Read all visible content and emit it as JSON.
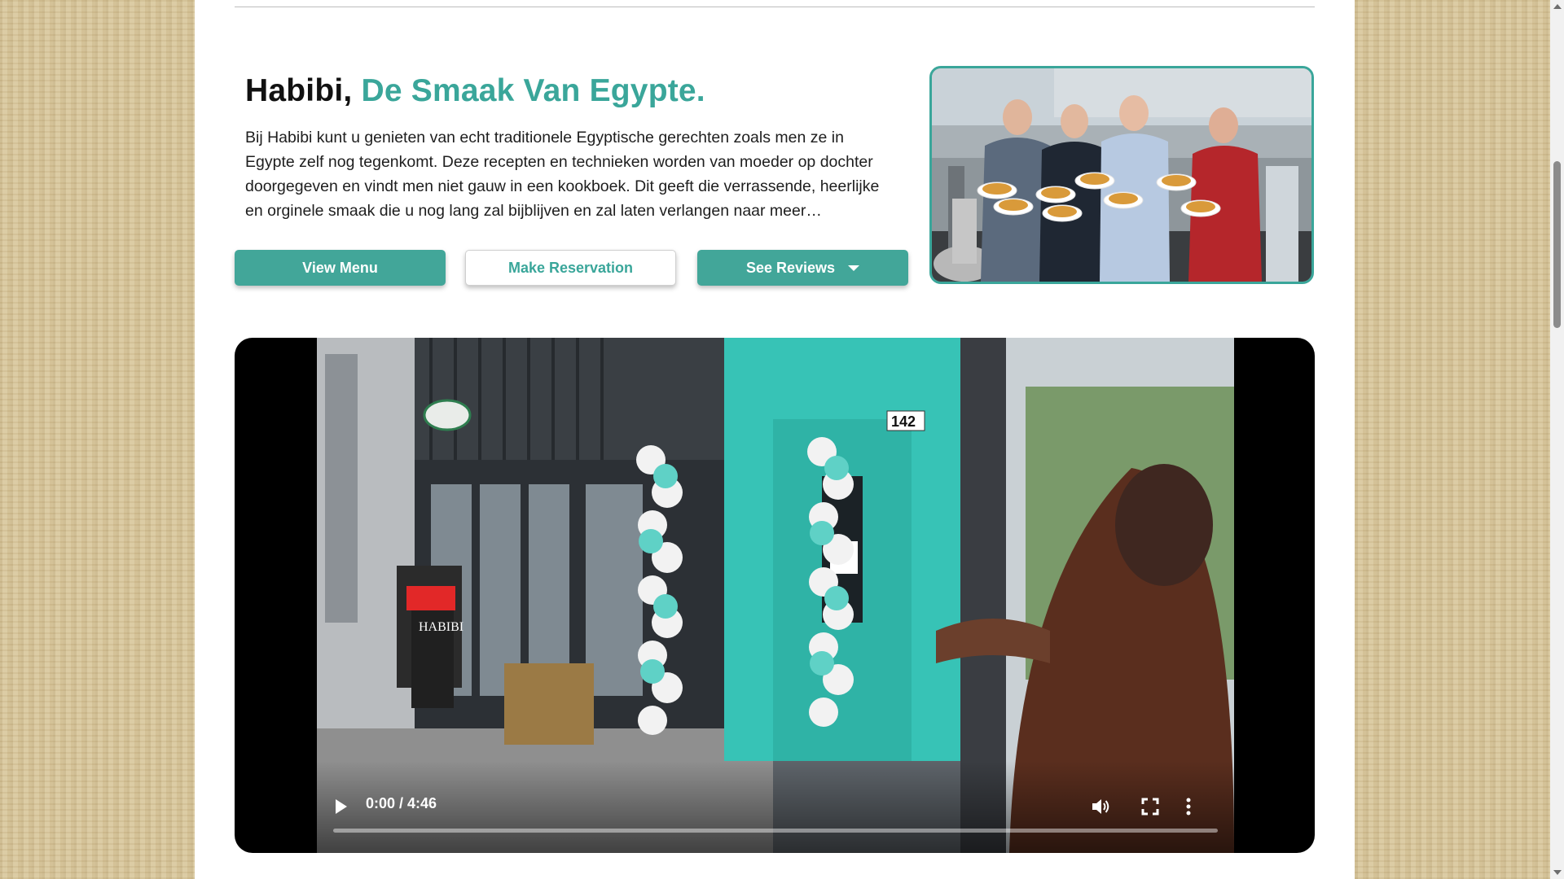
{
  "intro": {
    "title_main": "Habibi,",
    "title_accent": "De Smaak Van Egypte.",
    "description": "Bij Habibi kunt u genieten van echt traditionele Egyptische gerechten zoals men ze in Egypte zelf nog tegenkomt. Deze recepten en technieken worden van moeder op dochter doorgegeven en vindt men niet gauw in een kookboek. Dit geeft die verrassende, heerlijke en orginele smaak die u nog lang zal bijblijven en zal laten verlangen naar meer…"
  },
  "buttons": {
    "view_menu": "View Menu",
    "make_reservation": "Make Reservation",
    "see_reviews": "See Reviews"
  },
  "video": {
    "time_display": "0:00 / 4:46",
    "progress": 0.0,
    "storefront_number": "142",
    "signboard": "HABIBI"
  },
  "colors": {
    "accent": "#3aa69a",
    "button_bg": "#42a699",
    "shopfront": "#37c3b6"
  },
  "icons": [
    "play-icon",
    "volume-icon",
    "fullscreen-icon",
    "more-options-icon",
    "caret-down-icon"
  ]
}
